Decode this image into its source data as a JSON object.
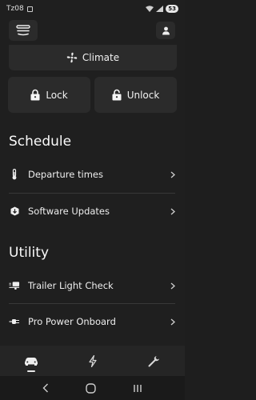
{
  "status_bar": {
    "time": "Tz08",
    "battery": "53"
  },
  "controls": {
    "climate_label": "Climate",
    "lock_label": "Lock",
    "unlock_label": "Unlock"
  },
  "schedule": {
    "heading": "Schedule",
    "items": [
      {
        "label": "Departure times",
        "icon": "thermometer-icon"
      },
      {
        "label": "Software Updates",
        "icon": "shield-update-icon"
      }
    ]
  },
  "utility": {
    "heading": "Utility",
    "items": [
      {
        "label": "Trailer Light Check",
        "icon": "trailer-icon"
      },
      {
        "label": "Pro Power Onboard",
        "icon": "plug-icon"
      }
    ]
  },
  "tabbar": {
    "items": [
      {
        "name": "vehicle-tab",
        "icon": "car-icon",
        "active": true
      },
      {
        "name": "charge-tab",
        "icon": "lightning-icon",
        "active": false
      },
      {
        "name": "service-tab",
        "icon": "wrench-icon",
        "active": false
      }
    ]
  },
  "colors": {
    "background": "#1f1f1f",
    "card": "#2b2b2b",
    "text": "#f2f2f2",
    "divider": "#383838"
  }
}
